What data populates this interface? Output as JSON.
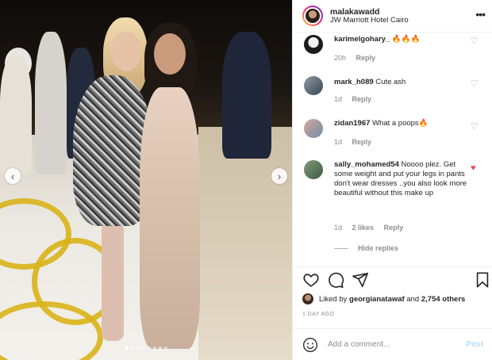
{
  "post": {
    "username": "malakawadd",
    "location": "JW Marriott Hotel Cairo"
  },
  "icons": {
    "more": "more-options-icon",
    "heart": "heart-icon",
    "comment": "comment-icon",
    "share": "share-icon",
    "save": "bookmark-icon",
    "emoji": "emoji-icon",
    "prev": "chevron-left-icon",
    "next": "chevron-right-icon"
  },
  "comments": [
    {
      "user": "karimelgohary_",
      "text": "🔥🔥🔥",
      "time": "20h",
      "likes": "",
      "reply": "Reply",
      "liked": false
    },
    {
      "user": "mark_h089",
      "text": "Cute ash",
      "time": "1d",
      "likes": "",
      "reply": "Reply",
      "liked": false
    },
    {
      "user": "zidan1967",
      "text": "What a poops🔥",
      "time": "1d",
      "likes": "",
      "reply": "Reply",
      "liked": false
    },
    {
      "user": "sally_mohamed54",
      "text": "Noooo plez. Get some weight and put your legs in pants don't wear dresses ..you also look more beautiful without this make up",
      "time": "1d",
      "likes": "2 likes",
      "reply": "Reply",
      "liked": true
    }
  ],
  "hide_replies": "Hide replies",
  "liked_by": {
    "prefix": "Liked by",
    "user": "georgianatawaf",
    "middle": "and",
    "count": "2,754 others"
  },
  "posted_ago": "1 DAY AGO",
  "add_comment": {
    "placeholder": "Add a comment...",
    "post_label": "Post"
  },
  "carousel": {
    "slides": 8,
    "active_index": 0
  },
  "colors": {
    "liked_heart": "#ed4956",
    "post_disabled": "#b2dffc",
    "muted": "#8e8e8e"
  }
}
